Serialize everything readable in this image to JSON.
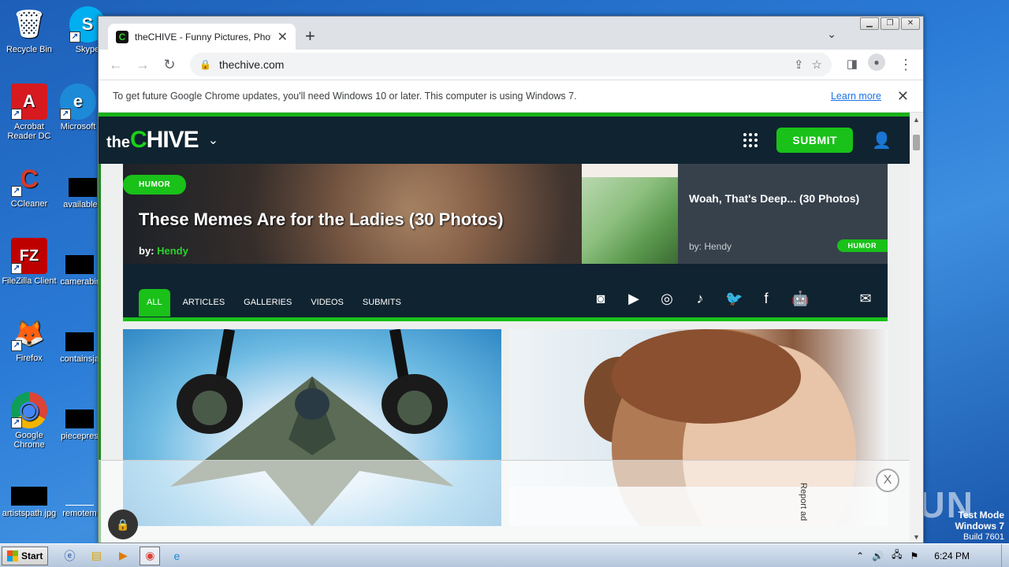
{
  "desktop": {
    "icons": [
      {
        "label": "Recycle Bin",
        "glyph": "🗑",
        "bg": "transparent"
      },
      {
        "label": "Skype",
        "glyph": "S",
        "bg": "#00aff0"
      },
      {
        "label": "Acrobat Reader DC",
        "glyph": "A",
        "bg": "#d71920"
      },
      {
        "label": "Microsoft",
        "glyph": "e",
        "bg": "#1d8ad8"
      },
      {
        "label": "CCleaner",
        "glyph": "C",
        "bg": "#d63a2a"
      },
      {
        "label": "availablea",
        "glyph": "",
        "bg": "#000"
      },
      {
        "label": "FileZilla Client",
        "glyph": "FZ",
        "bg": "#bf0000"
      },
      {
        "label": "camerabir",
        "glyph": "",
        "bg": "#000"
      },
      {
        "label": "Firefox",
        "glyph": "🦊",
        "bg": "transparent"
      },
      {
        "label": "containsja",
        "glyph": "",
        "bg": "#000"
      },
      {
        "label": "Google Chrome",
        "glyph": "◉",
        "bg": "transparent"
      },
      {
        "label": "piecepres",
        "glyph": "",
        "bg": "#000"
      },
      {
        "label": "artistspath.jpg",
        "glyph": "",
        "bg": "#000"
      },
      {
        "label": "remotem",
        "glyph": "",
        "bg": "#000"
      }
    ],
    "watermark": "ANY RUN",
    "test_mode": {
      "line1": "Test Mode",
      "line2": "Windows 7",
      "line3": "Build 7601"
    }
  },
  "browser": {
    "tab_title": "theCHIVE - Funny Pictures, Photos,",
    "favicon_letter": "C",
    "url": "thechive.com",
    "infobar": {
      "message": "To get future Google Chrome updates, you'll need Windows 10 or later. This computer is using Windows 7.",
      "link": "Learn more"
    }
  },
  "site": {
    "logo_the": "the",
    "logo_c": "C",
    "logo_rest": "HIVE",
    "submit_label": "SUBMIT",
    "hero": {
      "badge": "HUMOR",
      "title": "These Memes Are for the Ladies (30 Photos)",
      "by_label": "by:",
      "author": "Hendy"
    },
    "side_card": {
      "title": "Woah, That's Deep... (30 Photos)",
      "by": "by:  Hendy",
      "badge": "HUMOR"
    },
    "nav": [
      "ALL",
      "ARTICLES",
      "GALLERIES",
      "VIDEOS",
      "SUBMITS"
    ],
    "social_icons": [
      "discord-icon",
      "youtube-icon",
      "instagram-icon",
      "tiktok-icon",
      "twitter-icon",
      "facebook-icon",
      "android-icon",
      "apple-icon",
      "email-icon"
    ],
    "ad": {
      "report": "Report ad",
      "close": "X"
    }
  },
  "taskbar": {
    "start": "Start",
    "clock": "6:24 PM"
  },
  "colors": {
    "chive_green": "#19c119",
    "header_navy": "#102330"
  }
}
